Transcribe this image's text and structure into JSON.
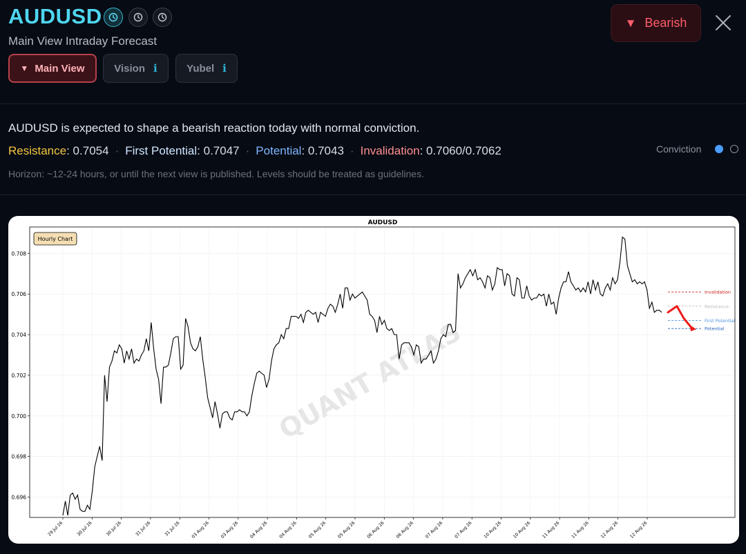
{
  "header": {
    "symbol": "AUDUSD",
    "subtitle": "Main View Intraday Forecast",
    "icons": [
      "clock-icon",
      "clock-icon",
      "clock-icon"
    ],
    "tabs": [
      {
        "label": "Main View",
        "active": true
      },
      {
        "label": "Vision",
        "info": "i"
      },
      {
        "label": "Yubel",
        "info": "i"
      }
    ],
    "bias_label": "Bearish"
  },
  "summary": {
    "text": "AUDUSD is expected to shape a bearish reaction today with normal conviction.",
    "resistance_label": "Resistance",
    "resistance_value": ": 0.7054",
    "first_potential_label": "First Potential",
    "first_potential_value": ": 0.7047",
    "potential_label": "Potential",
    "potential_value": ": 0.7043",
    "invalidation_label": "Invalidation",
    "invalidation_value": ": 0.7060/0.7062",
    "conviction_label": "Conviction",
    "conviction_level": 1,
    "conviction_max": 2,
    "horizon": "Horizon: ~12-24 hours, or until the next view is published. Levels should be treated as guidelines."
  },
  "colors": {
    "accent": "#4fd6f0",
    "bearish": "#ff5e6c",
    "resistance": "#f3c640",
    "invalidation": "#ff8f8f",
    "potential": "#7fb7ff"
  },
  "chart_data": {
    "type": "line",
    "title": "AUDUSD",
    "badge": "Hourly Chart",
    "watermark": "QUANT ATLAS",
    "ylim": [
      0.695,
      0.7093
    ],
    "yticks": [
      0.696,
      0.698,
      0.7,
      0.702,
      0.704,
      0.706,
      0.708
    ],
    "ytick_labels": [
      "0.696",
      "0.698",
      "0.700",
      "0.702",
      "0.704",
      "0.706",
      "0.708"
    ],
    "xticks": [
      "29 Jul 26",
      "30 Jul 26",
      "30 Jul 26",
      "31 Jul 26",
      "31 Jul 26",
      "03 Aug 26",
      "03 Aug 26",
      "04 Aug 26",
      "04 Aug 26",
      "05 Aug 26",
      "05 Aug 26",
      "06 Aug 26",
      "06 Aug 26",
      "07 Aug 26",
      "07 Aug 26",
      "10 Aug 26",
      "10 Aug 26",
      "11 Aug 26",
      "11 Aug 26",
      "12 Aug 26",
      "12 Aug 26"
    ],
    "grid": true,
    "series": [
      {
        "values": [
          0.6951,
          0.6958,
          0.6951,
          0.6961,
          0.6962,
          0.6959,
          0.6961,
          0.6954,
          0.6953,
          0.6953,
          0.6956,
          0.6954,
          0.6963,
          0.6975,
          0.698,
          0.6985,
          0.6978,
          0.702,
          0.7007,
          0.7024,
          0.7027,
          0.7032,
          0.7031,
          0.7035,
          0.7033,
          0.7026,
          0.7032,
          0.7028,
          0.7033,
          0.7026,
          0.7028,
          0.7027,
          0.703,
          0.7032,
          0.7038,
          0.7032,
          0.7046,
          0.7033,
          0.7023,
          0.7018,
          0.7006,
          0.7024,
          0.7024,
          0.7025,
          0.7031,
          0.7038,
          0.7039,
          0.7039,
          0.7023,
          0.7025,
          0.7048,
          0.7044,
          0.7036,
          0.7033,
          0.7032,
          0.7034,
          0.7039,
          0.7028,
          0.7019,
          0.7009,
          0.7004,
          0.6999,
          0.7007,
          0.7001,
          0.6994,
          0.7001,
          0.7002,
          0.7002,
          0.6999,
          0.6998,
          0.7002,
          0.7002,
          0.7003,
          0.7002,
          0.7002,
          0.7,
          0.7002,
          0.701,
          0.7016,
          0.7021,
          0.7022,
          0.7021,
          0.702,
          0.7014,
          0.7018,
          0.7027,
          0.7033,
          0.7035,
          0.7036,
          0.704,
          0.7038,
          0.7043,
          0.7043,
          0.7049,
          0.7049,
          0.7049,
          0.7048,
          0.705,
          0.7046,
          0.7051,
          0.7052,
          0.7051,
          0.705,
          0.7051,
          0.7046,
          0.7051,
          0.705,
          0.7049,
          0.7053,
          0.7055,
          0.7054,
          0.7051,
          0.7055,
          0.706,
          0.7053,
          0.7063,
          0.7063,
          0.7057,
          0.706,
          0.7058,
          0.7059,
          0.706,
          0.7061,
          0.7059,
          0.7057,
          0.705,
          0.7049,
          0.7047,
          0.7041,
          0.7049,
          0.7045,
          0.7047,
          0.7043,
          0.7042,
          0.7043,
          0.704,
          0.704,
          0.7028,
          0.7035,
          0.7036,
          0.7036,
          0.7036,
          0.7034,
          0.703,
          0.7035,
          0.7034,
          0.7026,
          0.7028,
          0.7028,
          0.703,
          0.7032,
          0.7026,
          0.7028,
          0.7032,
          0.7038,
          0.704,
          0.7039,
          0.7045,
          0.7045,
          0.7041,
          0.7042,
          0.707,
          0.7063,
          0.7065,
          0.7068,
          0.707,
          0.7072,
          0.7069,
          0.7072,
          0.7067,
          0.7068,
          0.7066,
          0.7063,
          0.7069,
          0.7068,
          0.7062,
          0.7065,
          0.7073,
          0.7072,
          0.7072,
          0.7064,
          0.707,
          0.7069,
          0.706,
          0.7059,
          0.7068,
          0.7067,
          0.7058,
          0.7058,
          0.7064,
          0.7059,
          0.7057,
          0.7058,
          0.7058,
          0.706,
          0.7059,
          0.706,
          0.7054,
          0.706,
          0.7055,
          0.7056,
          0.705,
          0.7058,
          0.7063,
          0.7066,
          0.7066,
          0.7071,
          0.7066,
          0.7064,
          0.7062,
          0.7063,
          0.7061,
          0.7063,
          0.7061,
          0.7066,
          0.706,
          0.7067,
          0.7062,
          0.7066,
          0.706,
          0.7059,
          0.7063,
          0.7065,
          0.7062,
          0.7068,
          0.7065,
          0.7067,
          0.7076,
          0.7088,
          0.7087,
          0.7074,
          0.707,
          0.7066,
          0.7067,
          0.7065,
          0.7066,
          0.7065,
          0.7066,
          0.7062,
          0.7053,
          0.7056,
          0.7051,
          0.7052,
          0.7052,
          0.7051
        ]
      }
    ],
    "forecast_path": [
      0.7051,
      0.7054,
      0.7048,
      0.7043
    ],
    "levels": [
      {
        "name": "Invalidation",
        "value": 0.7061,
        "color": "#d22020"
      },
      {
        "name": "Resistance",
        "value": 0.7054,
        "color": "#bbbbbb"
      },
      {
        "name": "First Potential",
        "value": 0.7047,
        "color": "#4a90e2"
      },
      {
        "name": "Potential",
        "value": 0.7043,
        "color": "#1f5fbf"
      }
    ]
  }
}
